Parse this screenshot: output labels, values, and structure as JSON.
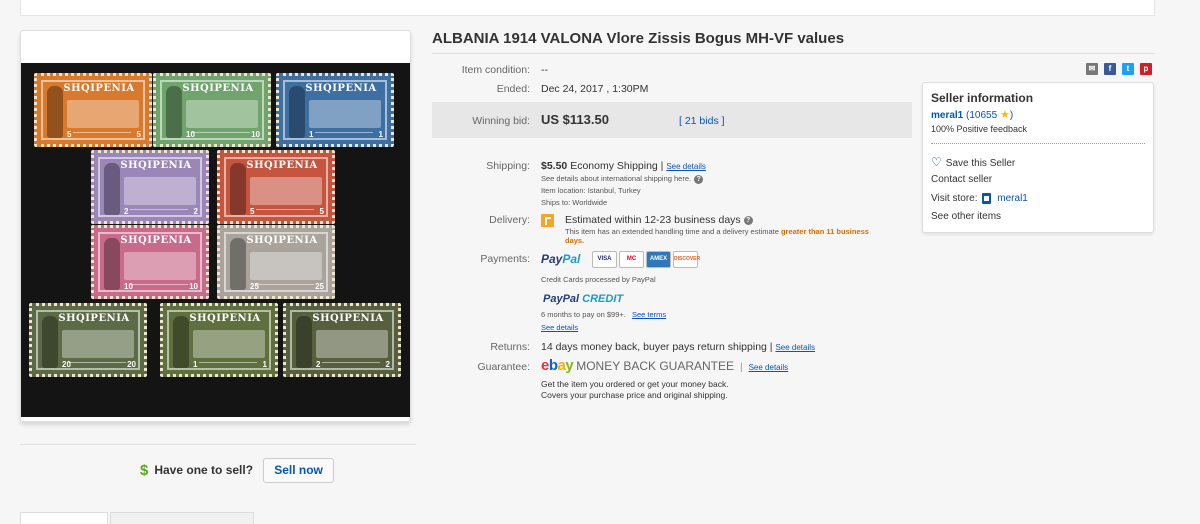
{
  "listing": {
    "title": "ALBANIA 1914 VALONA Vlore Zissis Bogus MH-VF values",
    "item_condition_label": "Item condition:",
    "item_condition_value": "--",
    "ended_label": "Ended:",
    "ended_value": "Dec 24, 2017 , 1:30PM",
    "winning_bid_label": "Winning bid:",
    "winning_bid_value": "US $113.50",
    "bids_link": "[ 21 bids ]"
  },
  "shipping": {
    "label": "Shipping:",
    "cost": "$5.50",
    "method": "Economy Shipping |",
    "see_details": "See details",
    "intl_note": "See details about international shipping here.",
    "item_location": "Item location:  Istanbul, Turkey",
    "ships_to": "Ships to:  Worldwide"
  },
  "delivery": {
    "label": "Delivery:",
    "estimate": "Estimated within 12-23 business days",
    "note_prefix": "This item has an extended handling time and a delivery estimate",
    "note_highlight": "greater than 11",
    "note_highlight2": "business days."
  },
  "payments": {
    "label": "Payments:",
    "paypal_1": "Pay",
    "paypal_2": "Pal",
    "cards": [
      "VISA",
      "MC",
      "AMEX",
      "DISCOVER"
    ],
    "credit_cards_note": "Credit Cards processed by PayPal",
    "paypal_credit_1": "PayPal",
    "paypal_credit_2": "CREDIT",
    "credit_terms": "6 months to pay on $99+.",
    "see_terms": "See terms",
    "see_details": "See details"
  },
  "returns": {
    "label": "Returns:",
    "text": "14 days money back, buyer pays return shipping |",
    "see_details": "See details"
  },
  "guarantee": {
    "label": "Guarantee:",
    "ebay": [
      "e",
      "b",
      "a",
      "y"
    ],
    "mbg": "MONEY BACK GUARANTEE",
    "see_details": "See details",
    "line1": "Get the item you ordered or get your money back.",
    "line2": "Covers your purchase price and original shipping."
  },
  "seller": {
    "heading": "Seller information",
    "name": "meral1",
    "feedback_count": "(10655",
    "feedback_close": ")",
    "positive": "100% Positive feedback",
    "save": "Save this Seller",
    "contact": "Contact seller",
    "visit_store_label": "Visit store:",
    "store_name": "meral1",
    "other_items": "See other items"
  },
  "sell": {
    "prompt": "Have one to sell?",
    "button": "Sell now"
  },
  "stamps": [
    {
      "color": "#d9792b",
      "banner": "SHQIPENIA",
      "vl": "5",
      "vr": "5"
    },
    {
      "color": "#6fa56c",
      "banner": "SHQIPENIA",
      "vl": "10",
      "vr": "10"
    },
    {
      "color": "#3d6fa3",
      "banner": "SHQIPENIA",
      "vl": "1",
      "vr": "1"
    },
    {
      "color": "#9b86b8",
      "banner": "SHQIPENIA",
      "vl": "2",
      "vr": "2"
    },
    {
      "color": "#c6553f",
      "banner": "SHQIPENIA",
      "vl": "5",
      "vr": "5"
    },
    {
      "color": "#c96a8a",
      "banner": "SHQIPENIA",
      "vl": "10",
      "vr": "10"
    },
    {
      "color": "#a9a39b",
      "banner": "SHQIPENIA",
      "vl": "25",
      "vr": "25"
    },
    {
      "color": "#5c6b45",
      "banner": "SHQIPENIA",
      "vl": "20",
      "vr": "20"
    },
    {
      "color": "#5f6f3e",
      "banner": "SHQIPENIA",
      "vl": "1",
      "vr": "1"
    },
    {
      "color": "#56603f",
      "banner": "SHQIPENIA",
      "vl": "2",
      "vr": "2"
    }
  ],
  "share_icons": [
    "email-share-icon",
    "facebook-icon",
    "twitter-icon",
    "pinterest-icon"
  ],
  "colors": {
    "link": "#0654ba",
    "accent_orange": "#f5a623",
    "highlight": "#dd6b00"
  }
}
